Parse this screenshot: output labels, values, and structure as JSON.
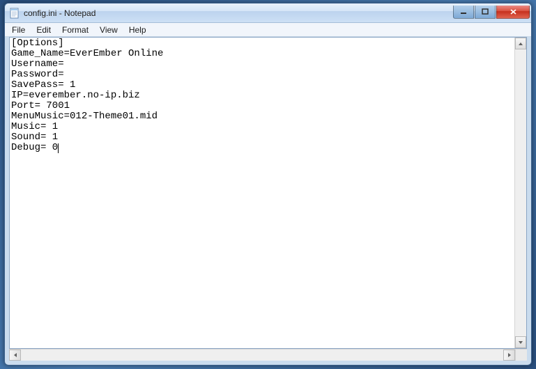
{
  "window": {
    "title": "config.ini - Notepad"
  },
  "menu": {
    "file": "File",
    "edit": "Edit",
    "format": "Format",
    "view": "View",
    "help": "Help"
  },
  "content": "[Options]\nGame_Name=EverEmber Online\nUsername=\nPassword=\nSavePass= 1\nIP=everember.no-ip.biz\nPort= 7001\nMenuMusic=012-Theme01.mid\nMusic= 1\nSound= 1\nDebug= 0"
}
